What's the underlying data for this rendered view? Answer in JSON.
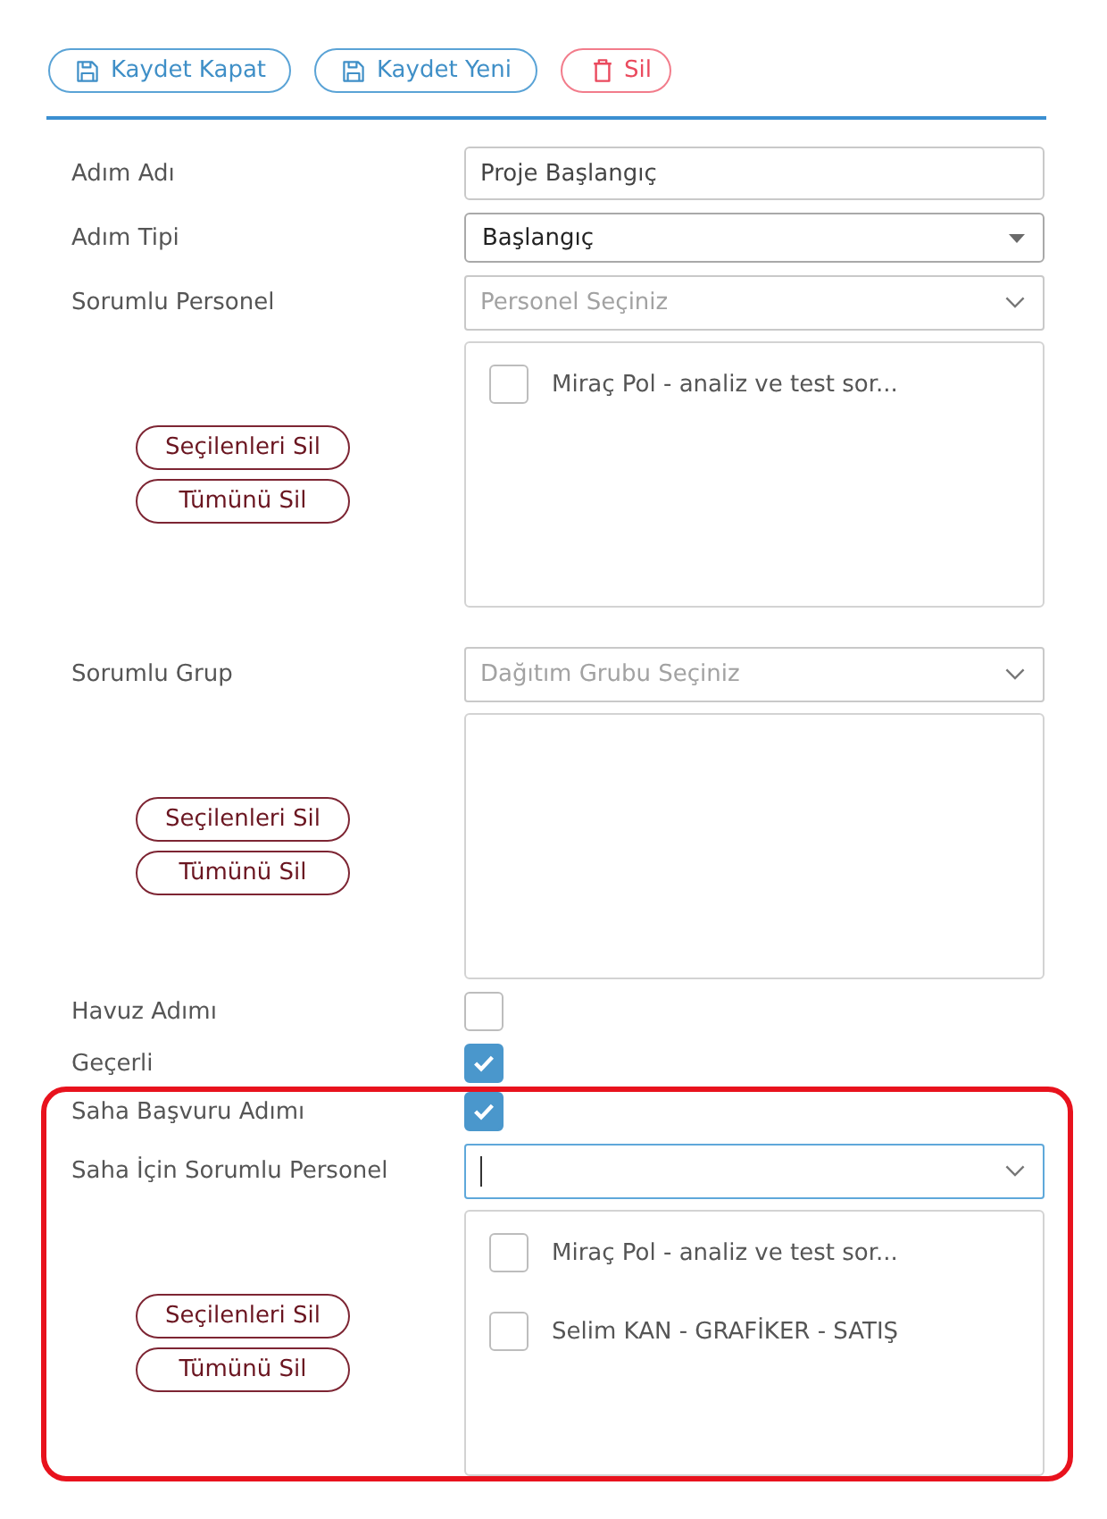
{
  "toolbar": {
    "buttons": [
      {
        "kind": "save",
        "label": "Kaydet Kapat"
      },
      {
        "kind": "save",
        "label": "Kaydet Yeni"
      },
      {
        "kind": "delete",
        "label": "Sil"
      }
    ]
  },
  "sections": [
    {
      "highlighted": false,
      "fields": [
        {
          "kind": "text",
          "label": "Adım Adı",
          "value": "Proje Başlangıç"
        },
        {
          "kind": "dropdown",
          "label": "Adım Tipi",
          "value": "Başlangıç"
        },
        {
          "kind": "picker",
          "label": "Sorumlu Personel",
          "placeholder": "Personel Seçiniz",
          "focused": false,
          "items": [
            {
              "label": "Miraç Pol - analiz ve test sor...",
              "checked": false
            }
          ],
          "buttons": [
            "Seçilenleri Sil",
            "Tümünü Sil"
          ]
        },
        {
          "kind": "picker",
          "label": "Sorumlu Grup",
          "placeholder": "Dağıtım Grubu Seçiniz",
          "focused": false,
          "buttons": [
            "Seçilenleri Sil",
            "Tümünü Sil"
          ]
        },
        {
          "kind": "checkbox",
          "label": "Havuz Adımı",
          "checked": false
        },
        {
          "kind": "checkbox",
          "label": "Geçerli",
          "checked": true
        }
      ]
    },
    {
      "highlighted": true,
      "fields": [
        {
          "kind": "checkbox",
          "label": "Saha Başvuru Adımı",
          "checked": true
        },
        {
          "kind": "picker",
          "label": "Saha İçin Sorumlu Personel",
          "focused": true,
          "items": [
            {
              "label": "Miraç Pol - analiz ve test sor...",
              "checked": false
            },
            {
              "label": "Selim KAN - GRAFİKER - SATIŞ",
              "checked": false
            }
          ],
          "buttons": [
            "Seçilenleri Sil",
            "Tümünü Sil"
          ]
        }
      ]
    }
  ]
}
